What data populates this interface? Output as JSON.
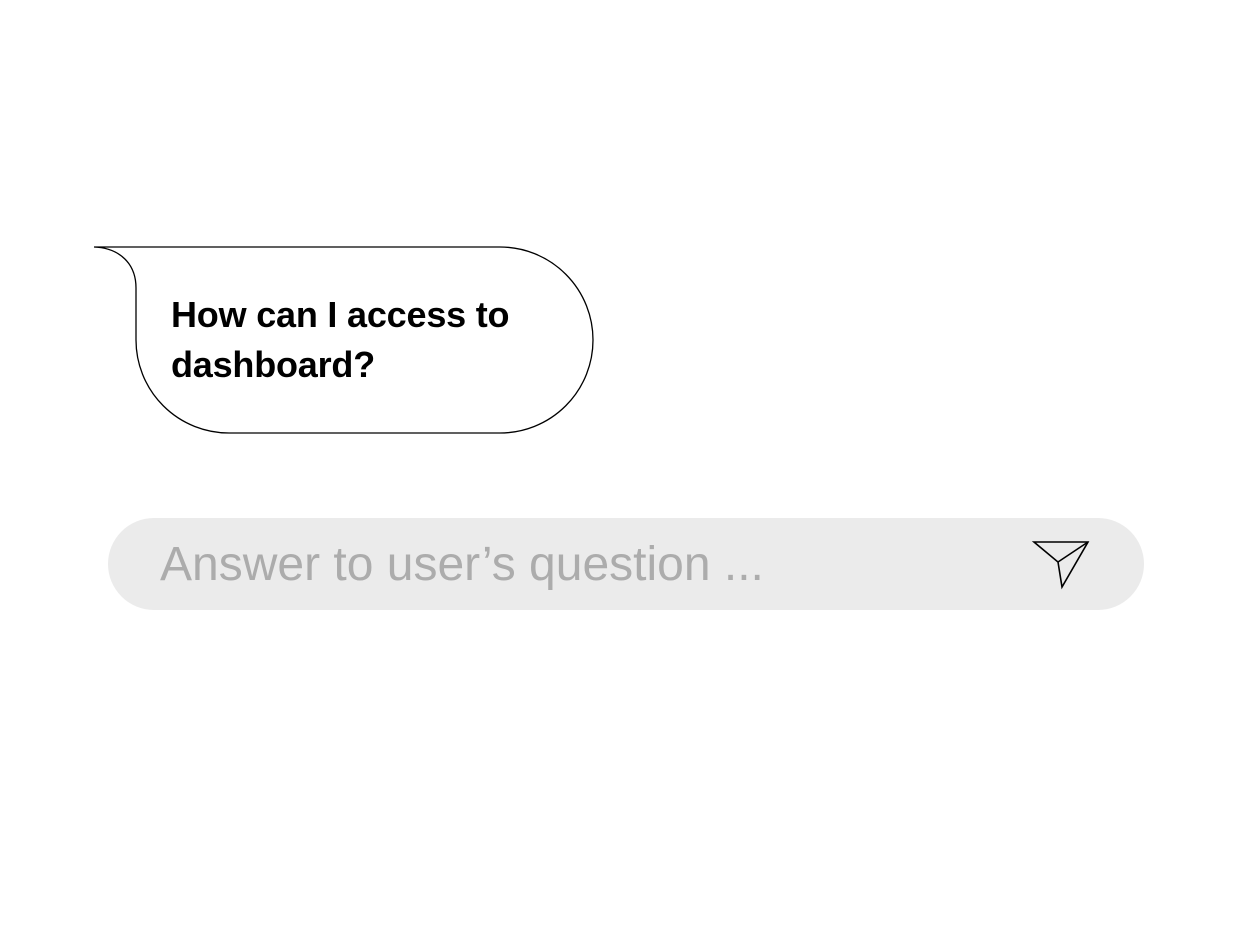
{
  "chat": {
    "messages": [
      {
        "sender": "user",
        "text": "How can I access to dashboard?"
      }
    ]
  },
  "composer": {
    "placeholder": "Answer to user’s question ...",
    "value": "",
    "send_icon": "paper-plane-icon"
  },
  "colors": {
    "background": "#ffffff",
    "bubble_fill": "#ffffff",
    "bubble_stroke": "#000000",
    "message_text": "#000000",
    "composer_background": "#ebebeb",
    "placeholder_text": "#acacac",
    "icon_stroke": "#000000"
  }
}
